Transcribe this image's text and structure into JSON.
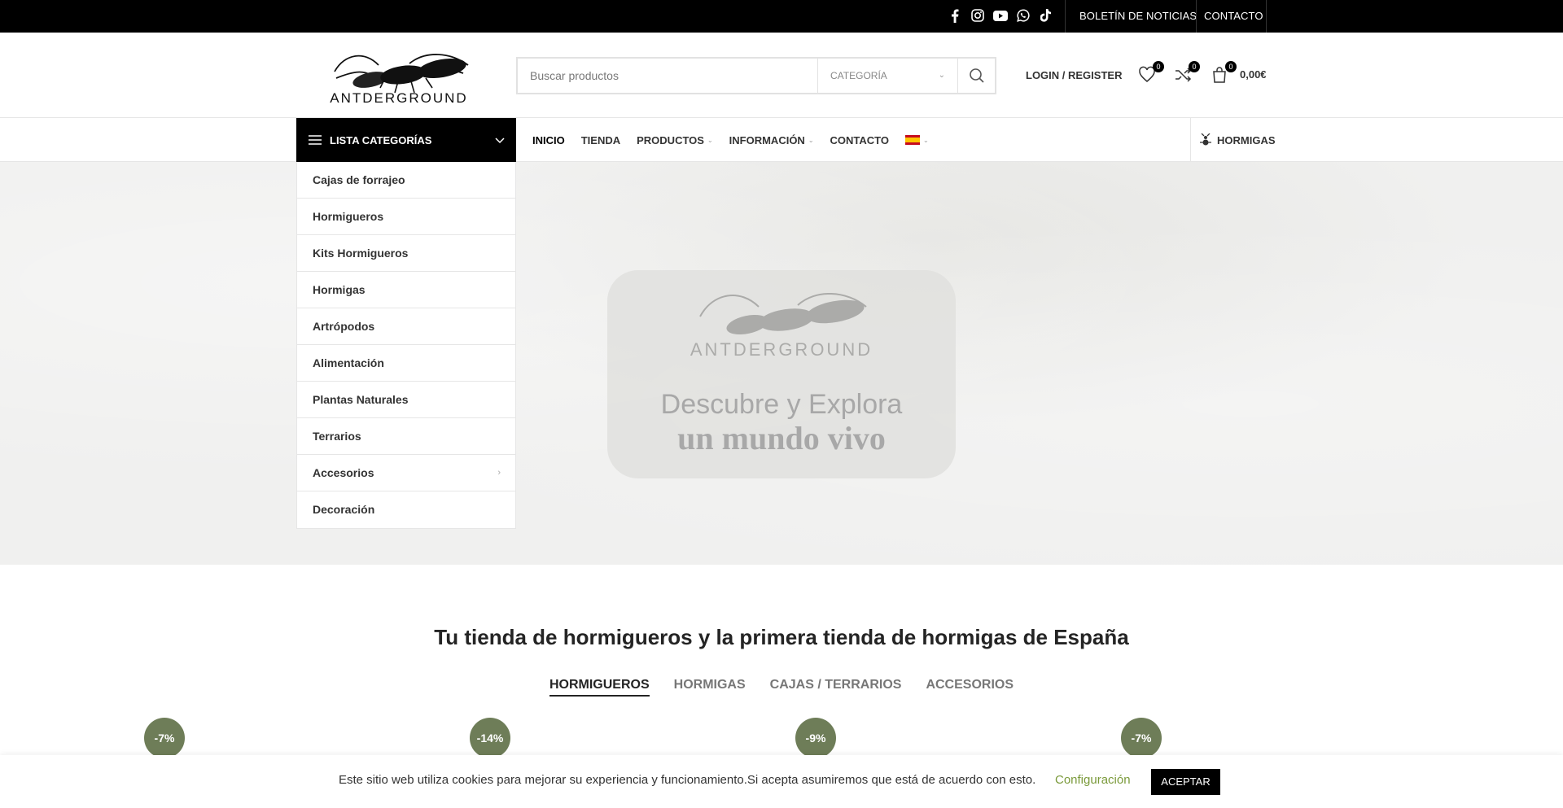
{
  "topbar": {
    "social_icons": [
      "facebook-icon",
      "instagram-icon",
      "youtube-icon",
      "whatsapp-icon",
      "tiktok-icon"
    ],
    "newsletter": "BOLETÍN DE NOTICIAS",
    "contact": "CONTACTO"
  },
  "brand": {
    "name": "ANTDERGROUND"
  },
  "search": {
    "placeholder": "Buscar productos",
    "category": "CATEGORÍA"
  },
  "header": {
    "login": "LOGIN / REGISTER",
    "wishlist_count": "0",
    "compare_count": "0",
    "cart_count": "0",
    "cart_total": "0,00€"
  },
  "nav": {
    "categories_button": "LISTA CATEGORÍAS",
    "items": [
      "INICIO",
      "TIENDA",
      "PRODUCTOS",
      "INFORMACIÓN",
      "CONTACTO"
    ],
    "right_link": "HORMIGAS"
  },
  "categories": [
    "Cajas de forrajeo",
    "Hormigueros",
    "Kits Hormigueros",
    "Hormigas",
    "Artrópodos",
    "Alimentación",
    "Plantas Naturales",
    "Terrarios",
    "Accesorios",
    "Decoración"
  ],
  "hero": {
    "logo_text": "ANTDERGROUND",
    "line1": "Descubre y Explora",
    "line2": "un mundo vivo"
  },
  "main": {
    "headline": "Tu tienda de hormigueros y la primera tienda de hormigas de España",
    "tabs": [
      "HORMIGUEROS",
      "HORMIGAS",
      "CAJAS / TERRARIOS",
      "ACCESORIOS"
    ],
    "discounts": [
      "-7%",
      "-14%",
      "-9%",
      "-7%"
    ]
  },
  "cookie": {
    "text": "Este sitio web utiliza cookies para mejorar su experiencia y funcionamiento.Si acepta asumiremos que está de acuerdo con esto.",
    "settings": "Configuración",
    "accept": "ACEPTAR"
  },
  "colors": {
    "accent_green": "#6e7d58",
    "link_green": "#7a9a3a"
  }
}
